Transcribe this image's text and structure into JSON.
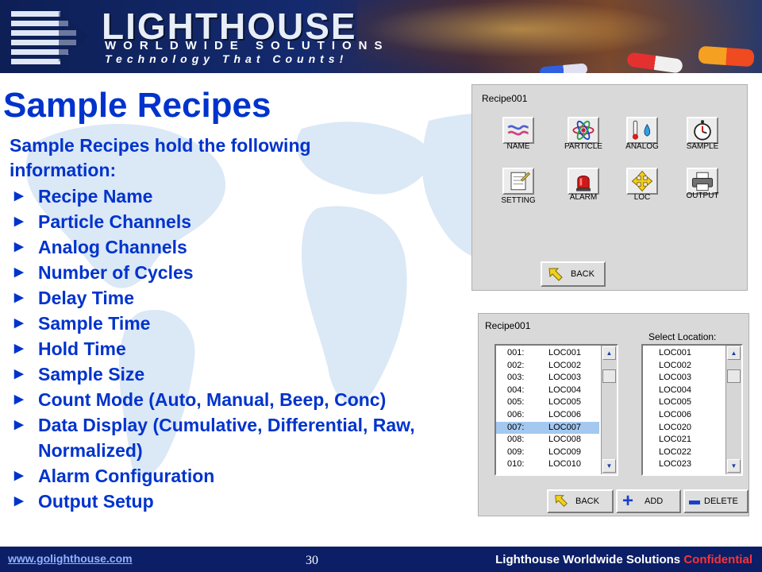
{
  "header": {
    "company_name": "LIGHTHOUSE",
    "company_sub": "WORLDWIDE SOLUTIONS",
    "tagline": "Technology That Counts!"
  },
  "slide": {
    "title": "Sample Recipes",
    "intro": "Sample Recipes hold the following information:",
    "bullets": [
      "Recipe Name",
      "Particle Channels",
      "Analog Channels",
      "Number of Cycles",
      "Delay Time",
      "Sample Time",
      "Hold Time",
      "Sample Size",
      "Count Mode (Auto, Manual, Beep, Conc)",
      "Data Display (Cumulative, Differential, Raw, Normalized)",
      "Alarm Configuration",
      "Output Setup"
    ]
  },
  "recipe_screen": {
    "title": "Recipe001",
    "tiles": [
      {
        "label": "NAME",
        "icon": "name-wave-icon"
      },
      {
        "label": "PARTICLE",
        "icon": "atom-icon"
      },
      {
        "label": "ANALOG",
        "icon": "thermometer-icon"
      },
      {
        "label": "SAMPLE",
        "icon": "stopwatch-icon"
      },
      {
        "label": "SETTING",
        "icon": "notepad-icon"
      },
      {
        "label": "ALARM",
        "icon": "alarm-light-icon"
      },
      {
        "label": "LOC",
        "icon": "move-arrows-icon"
      },
      {
        "label": "OUTPUT",
        "icon": "printer-icon"
      }
    ],
    "back_label": "BACK"
  },
  "location_screen": {
    "title": "Recipe001",
    "select_label": "Select Location:",
    "assigned": [
      {
        "num": "001:",
        "loc": "LOC001"
      },
      {
        "num": "002:",
        "loc": "LOC002"
      },
      {
        "num": "003:",
        "loc": "LOC003"
      },
      {
        "num": "004:",
        "loc": "LOC004"
      },
      {
        "num": "005:",
        "loc": "LOC005"
      },
      {
        "num": "006:",
        "loc": "LOC006"
      },
      {
        "num": "007:",
        "loc": "LOC007"
      },
      {
        "num": "008:",
        "loc": "LOC008"
      },
      {
        "num": "009:",
        "loc": "LOC009"
      },
      {
        "num": "010:",
        "loc": "LOC010"
      }
    ],
    "selected_index": 6,
    "available": [
      "LOC001",
      "LOC002",
      "LOC003",
      "LOC004",
      "LOC005",
      "LOC006",
      "LOC020",
      "LOC021",
      "LOC022",
      "LOC023"
    ],
    "back_label": "BACK",
    "add_label": "ADD",
    "delete_label": "DELETE",
    "selection_color": "#a4c8f0"
  },
  "footer": {
    "url": "www.golighthouse.com",
    "page_number": "30",
    "company": "Lighthouse Worldwide Solutions",
    "confidential": "Confidential"
  },
  "colors": {
    "title_blue": "#0033cc",
    "footer_bg": "#0c1e66",
    "confidential_red": "#ff3333"
  }
}
